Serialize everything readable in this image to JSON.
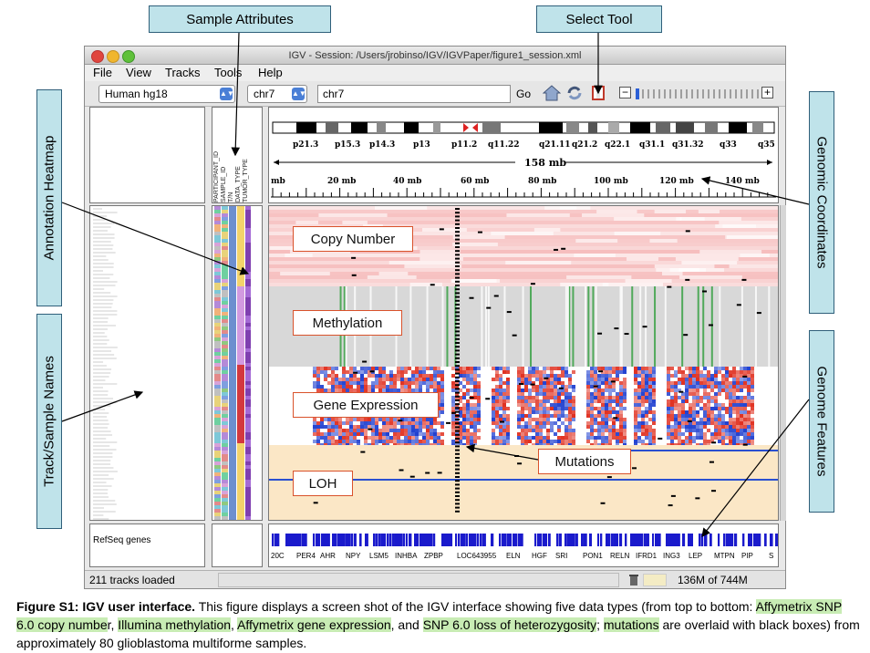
{
  "callouts": {
    "sample_attributes": "Sample Attributes",
    "select_tool": "Select Tool",
    "annotation_heatmap": "Annotation Heatmap",
    "track_sample_names": "Track/Sample Names",
    "genomic_coordinates": "Genomic Coordinates",
    "genome_features": "Genome Features"
  },
  "window": {
    "title": "IGV - Session: /Users/jrobinso/IGV/IGVPaper/figure1_session.xml",
    "menu": [
      "File",
      "View",
      "Tracks",
      "Tools",
      "Help"
    ],
    "toolbar": {
      "genome": "Human hg18",
      "chromosome": "chr7",
      "locus": "chr7",
      "go_label": "Go"
    },
    "attribute_columns": [
      "PARTICIPANT_ID",
      "SAMPLE_ID",
      "T/N",
      "DATA_TYPE",
      "TUMOR_TYPE"
    ],
    "cytobands": [
      "p21.3",
      "p15.3",
      "p14.3",
      "p13",
      "p11.2",
      "q11.22",
      "q21.11",
      "q21.2",
      "q22.1",
      "q31.1",
      "q31.32",
      "q33",
      "q35"
    ],
    "span_label": "158 mb",
    "ruler_ticks": [
      "mb",
      "20 mb",
      "40 mb",
      "60 mb",
      "80 mb",
      "100 mb",
      "120 mb",
      "140 mb"
    ],
    "data_labels": {
      "copy_number": "Copy Number",
      "methylation": "Methylation",
      "gene_expression": "Gene Expression",
      "loh": "LOH",
      "mutations": "Mutations"
    },
    "feature_track_name": "RefSeq genes",
    "genes": [
      "20C",
      "PER4",
      "AHR",
      "NPY",
      "LSM5",
      "INHBA",
      "ZPBP",
      "LOC643955",
      "ELN",
      "HGF",
      "SRI",
      "PON1",
      "RELN",
      "IFRD1",
      "ING3",
      "LEP",
      "MTPN",
      "PIP",
      "S"
    ],
    "status": {
      "tracks_loaded": "211 tracks loaded",
      "memory": "136M of 744M"
    }
  },
  "caption": {
    "bold": "Figure S1: IGV user interface.",
    "t1": " This figure displays a screen shot of the IGV interface showing five data types (from top to bottom: ",
    "h1": "Affymetrix SNP 6.0 copy numbe",
    "t2": "r, ",
    "h2": "Illumina methylation",
    "t3": ", ",
    "h3": "Affymetrix gene expression",
    "t4": ", and ",
    "h4": "SNP 6.0 loss of heterozygosity",
    "t5": "; ",
    "h5": "mutations",
    "t6": " are overlaid with black boxes) from approximately 80 glioblastoma multiforme samples."
  },
  "colors": {
    "callout_fill": "#bfe3ea",
    "label_border": "#d9522b",
    "copy_number": "#f2a0a0",
    "methylation_bg": "#d8d8d8",
    "expression_red": "#e03020",
    "expression_blue": "#2040d0",
    "loh_bg": "#fbe7c6",
    "genes": "#1a1acc",
    "highlight": "#c8ecb4"
  }
}
